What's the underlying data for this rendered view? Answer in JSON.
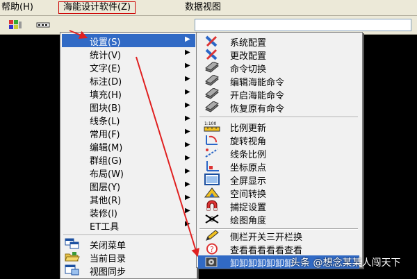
{
  "menubar": {
    "help": "帮助(H)",
    "hainen": "海能设计软件(Z)",
    "data_view": "数据视图"
  },
  "menu1": {
    "items": [
      {
        "label": "设置(S)",
        "highlighted": true,
        "submenu": true
      },
      {
        "label": "统计(V)",
        "submenu": true
      },
      {
        "label": "文字(E)",
        "submenu": true
      },
      {
        "label": "标注(D)",
        "submenu": true
      },
      {
        "label": "填充(H)",
        "submenu": true
      },
      {
        "label": "图块(B)",
        "submenu": true
      },
      {
        "label": "线条(L)",
        "submenu": true
      },
      {
        "label": "常用(F)",
        "submenu": true
      },
      {
        "label": "编辑(M)",
        "submenu": true
      },
      {
        "label": "群组(G)",
        "submenu": true
      },
      {
        "label": "布局(W)",
        "submenu": true
      },
      {
        "label": "图层(Y)",
        "submenu": true
      },
      {
        "label": "其他(R)",
        "submenu": true
      },
      {
        "label": "装修(I)",
        "submenu": true
      },
      {
        "label": "ET工具",
        "submenu": true
      }
    ],
    "bottom_items": [
      {
        "label": "关闭菜单",
        "icon": "windows-icon"
      },
      {
        "label": "当前目录",
        "icon": "folder-icon"
      },
      {
        "label": "视图同步",
        "icon": "view-sync-icon"
      }
    ]
  },
  "menu2": {
    "items": [
      {
        "label": "系统配置",
        "icon": "tools-icon"
      },
      {
        "label": "更改配置",
        "icon": "tools-icon"
      },
      {
        "label": "命令切换",
        "icon": "layers-icon"
      },
      {
        "label": "编辑海能命令",
        "icon": "layers-icon"
      },
      {
        "label": "开启海能命令",
        "icon": "layers-icon"
      },
      {
        "label": "恢复原有命令",
        "icon": "layers-icon"
      },
      {
        "label": "比例更新",
        "icon": "scale-icon",
        "icon_text": "1:100"
      },
      {
        "label": "旋转视角",
        "icon": "rotate-view-icon"
      },
      {
        "label": "线条比例",
        "icon": "line-scale-icon"
      },
      {
        "label": "坐标原点",
        "icon": "origin-icon"
      },
      {
        "label": "全屏显示",
        "icon": "fullscreen-icon"
      },
      {
        "label": "空间转换",
        "icon": "space-convert-icon"
      },
      {
        "label": "捕捉设置",
        "icon": "magnet-icon"
      },
      {
        "label": "绘图角度",
        "icon": "angle-icon"
      },
      {
        "label": "侧栏开关三开栏换",
        "icon": "pencil-icon"
      },
      {
        "label": "查看看看看看查看",
        "icon": "help-circle-icon"
      },
      {
        "label": "卸卸卸卸卸卸卸",
        "icon": "uninstall-icon",
        "highlighted": true
      }
    ]
  },
  "watermark": "头条 @想念某某人闯天下",
  "colors": {
    "highlight": "#316ac5",
    "menu_bg": "#f1f1f1",
    "bar_bg": "#ece9d8",
    "arrow": "#e02020"
  }
}
